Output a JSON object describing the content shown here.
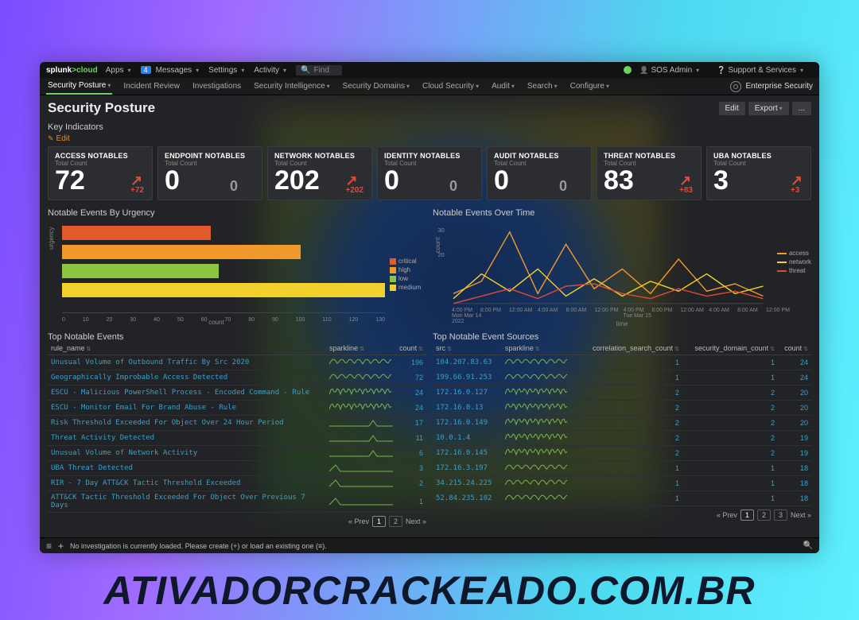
{
  "topbar": {
    "logo_a": "splunk",
    "logo_b": ">cloud",
    "apps": "Apps",
    "msg_count": "4",
    "messages": "Messages",
    "settings": "Settings",
    "activity": "Activity",
    "find": "Find",
    "user": "SOS Admin",
    "support": "Support & Services"
  },
  "menubar": {
    "items": [
      "Security Posture",
      "Incident Review",
      "Investigations",
      "Security Intelligence",
      "Security Domains",
      "Cloud Security",
      "Audit",
      "Search",
      "Configure"
    ],
    "right": "Enterprise Security"
  },
  "page": {
    "title": "Security Posture",
    "edit": "Edit",
    "export": "Export",
    "more": "..."
  },
  "ki": {
    "heading": "Key Indicators",
    "edit": "Edit",
    "totalcount": "Total Count"
  },
  "kpis": [
    {
      "label": "ACCESS NOTABLES",
      "val": "72",
      "sec": "",
      "trend": "+72"
    },
    {
      "label": "ENDPOINT NOTABLES",
      "val": "0",
      "sec": "0",
      "trend": ""
    },
    {
      "label": "NETWORK NOTABLES",
      "val": "202",
      "sec": "",
      "trend": "+202"
    },
    {
      "label": "IDENTITY NOTABLES",
      "val": "0",
      "sec": "0",
      "trend": ""
    },
    {
      "label": "AUDIT NOTABLES",
      "val": "0",
      "sec": "0",
      "trend": ""
    },
    {
      "label": "THREAT NOTABLES",
      "val": "83",
      "sec": "",
      "trend": "+83"
    },
    {
      "label": "UBA NOTABLES",
      "val": "3",
      "sec": "",
      "trend": "+3"
    }
  ],
  "urgency": {
    "title": "Notable Events By Urgency",
    "ylab": "urgency",
    "xlab": "count",
    "legend": {
      "critical": "critical",
      "high": "high",
      "low": "low",
      "medium": "medium"
    },
    "ticks": [
      "0",
      "10",
      "20",
      "30",
      "40",
      "50",
      "60",
      "70",
      "80",
      "90",
      "100",
      "110",
      "120",
      "130"
    ]
  },
  "overtime": {
    "title": "Notable Events Over Time",
    "ylab": "count",
    "legend": {
      "access": "access",
      "network": "network",
      "threat": "threat"
    },
    "xl": [
      "4:00 PM",
      "8:00 PM",
      "12:00 AM",
      "4:00 AM",
      "8:00 AM",
      "12:00 PM",
      "4:00 PM",
      "8:00 PM",
      "12:00 AM",
      "4:00 AM",
      "8:00 AM",
      "12:00 PM"
    ],
    "dl": [
      "Mon Mar 14",
      "",
      "",
      "",
      "",
      "",
      "Tue Mar 15",
      "",
      "",
      "",
      "",
      ""
    ],
    "yr": "2022",
    "time": "time",
    "y30": "30",
    "y20": "20"
  },
  "tne": {
    "title": "Top Notable Events",
    "cols": {
      "rule": "rule_name",
      "spark": "sparkline",
      "count": "count"
    },
    "rows": [
      {
        "rule": "Unusual Volume of Outbound Traffic By Src 2020",
        "count": "196",
        "sp": 0
      },
      {
        "rule": "Geographically Improbable Access Detected",
        "count": "72",
        "sp": 0
      },
      {
        "rule": "ESCU - Malicious PowerShell Process - Encoded Command - Rule",
        "count": "24",
        "sp": 1
      },
      {
        "rule": "ESCU - Monitor Email For Brand Abuse - Rule",
        "count": "24",
        "sp": 1
      },
      {
        "rule": "Risk Threshold Exceeded For Object Over 24 Hour Period",
        "count": "17",
        "sp": 2
      },
      {
        "rule": "Threat Activity Detected",
        "count": "11",
        "sp": 2
      },
      {
        "rule": "Unusual Volume of Network Activity",
        "count": "6",
        "sp": 2
      },
      {
        "rule": "UBA Threat Detected",
        "count": "3",
        "sp": 3
      },
      {
        "rule": "RIR - 7 Day ATT&CK Tactic Threshold Exceeded",
        "count": "2",
        "sp": 3
      },
      {
        "rule": "ATT&CK Tactic Threshold Exceeded For Object Over Previous 7 Days",
        "count": "1",
        "sp": 3
      }
    ],
    "pager": {
      "prev": "« Prev",
      "p1": "1",
      "p2": "2",
      "next": "Next »"
    }
  },
  "tnes": {
    "title": "Top Notable Event Sources",
    "cols": {
      "src": "src",
      "spark": "sparkline",
      "corr": "correlation_search_count",
      "dom": "security_domain_count",
      "count": "count"
    },
    "rows": [
      {
        "src": "104.207.83.63",
        "corr": "1",
        "dom": "1",
        "count": "24",
        "sp": 0
      },
      {
        "src": "199.66.91.253",
        "corr": "1",
        "dom": "1",
        "count": "24",
        "sp": 0
      },
      {
        "src": "172.16.0.127",
        "corr": "2",
        "dom": "2",
        "count": "20",
        "sp": 1
      },
      {
        "src": "172.16.0.13",
        "corr": "2",
        "dom": "2",
        "count": "20",
        "sp": 1
      },
      {
        "src": "172.16.0.149",
        "corr": "2",
        "dom": "2",
        "count": "20",
        "sp": 1
      },
      {
        "src": "10.0.1.4",
        "corr": "2",
        "dom": "2",
        "count": "19",
        "sp": 1
      },
      {
        "src": "172.16.0.145",
        "corr": "2",
        "dom": "2",
        "count": "19",
        "sp": 1
      },
      {
        "src": "172.16.3.197",
        "corr": "1",
        "dom": "1",
        "count": "18",
        "sp": 0
      },
      {
        "src": "34.215.24.225",
        "corr": "1",
        "dom": "1",
        "count": "18",
        "sp": 0
      },
      {
        "src": "52.84.235.102",
        "corr": "1",
        "dom": "1",
        "count": "18",
        "sp": 0
      }
    ],
    "pager": {
      "prev": "« Prev",
      "p1": "1",
      "p2": "2",
      "p3": "3",
      "next": "Next »"
    }
  },
  "invest": {
    "msg": "No investigation is currently loaded. Please create (+) or load an existing one (≡)."
  },
  "watermark": "ATIVADORCRACKEADO.COM.BR",
  "chart_data": [
    {
      "type": "bar",
      "orientation": "horizontal",
      "title": "Notable Events By Urgency",
      "xlabel": "count",
      "ylabel": "urgency",
      "xlim": [
        0,
        130
      ],
      "categories": [
        "critical",
        "high",
        "low",
        "medium"
      ],
      "values": [
        60,
        96,
        63,
        130
      ],
      "colors": [
        "#e05a2c",
        "#f2992c",
        "#8cc63f",
        "#f2d12c"
      ]
    },
    {
      "type": "line",
      "title": "Notable Events Over Time",
      "xlabel": "time",
      "ylabel": "count",
      "ylim": [
        0,
        30
      ],
      "x": [
        "Mon 4:00 PM",
        "Mon 8:00 PM",
        "Tue 12:00 AM",
        "Tue 4:00 AM",
        "Tue 8:00 AM",
        "Tue 12:00 PM",
        "Tue 4:00 PM",
        "Tue 8:00 PM",
        "Wed 12:00 AM",
        "Wed 4:00 AM",
        "Wed 8:00 AM",
        "Wed 12:00 PM"
      ],
      "series": [
        {
          "name": "access",
          "color": "#f2992c",
          "values": [
            4,
            9,
            29,
            4,
            24,
            6,
            14,
            4,
            18,
            5,
            8,
            3
          ]
        },
        {
          "name": "network",
          "color": "#f2d12c",
          "values": [
            2,
            12,
            5,
            14,
            3,
            10,
            3,
            9,
            5,
            12,
            4,
            7
          ]
        },
        {
          "name": "threat",
          "color": "#e04a3a",
          "values": [
            0,
            3,
            6,
            2,
            7,
            8,
            4,
            2,
            6,
            3,
            5,
            2
          ]
        }
      ]
    }
  ]
}
